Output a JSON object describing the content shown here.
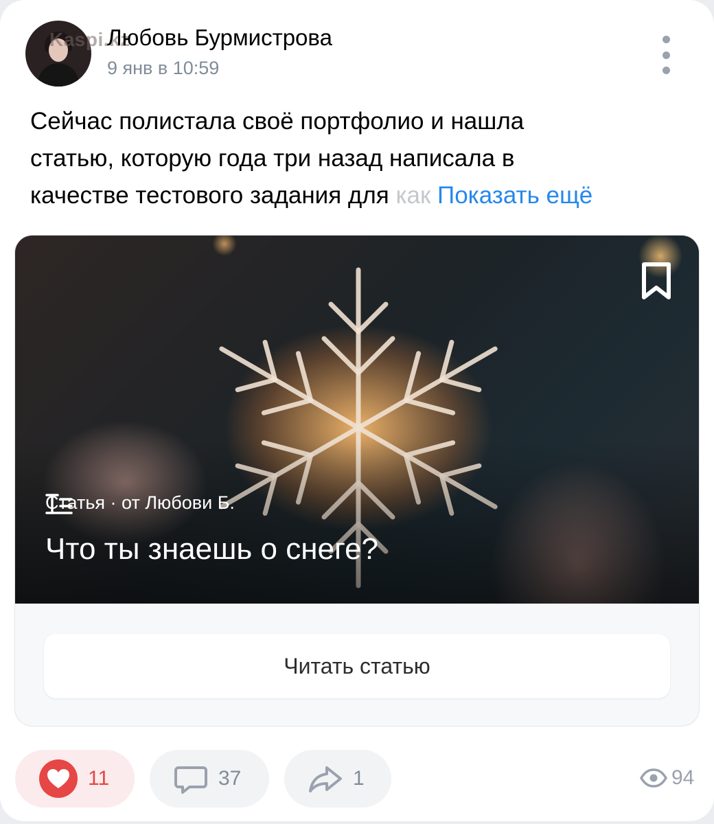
{
  "post": {
    "author": "Любовь Бурмистрова",
    "date": "9 янв в 10:59",
    "watermark": "Kaspi.kz",
    "text_lines": [
      "Сейчас полистала своё портфолио и нашла",
      "статью, которую года три назад написала в",
      "качестве тестового задания для "
    ],
    "text_fade": "как",
    "show_more": "Показать ещё"
  },
  "article": {
    "meta": "Статья · от Любови Б.",
    "title": "Что ты знаешь о снеге?",
    "read_label": "Читать статью"
  },
  "footer": {
    "likes": "11",
    "comments": "37",
    "shares": "1",
    "views": "94"
  },
  "colors": {
    "accent": "#2688eb",
    "like_red": "#e64646",
    "secondary_text": "#818c99"
  }
}
